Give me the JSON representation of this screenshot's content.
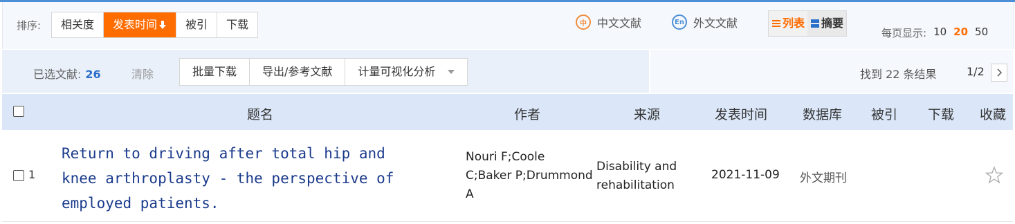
{
  "sort": {
    "label": "排序:",
    "options": [
      "相关度",
      "发表时间",
      "被引",
      "下载"
    ],
    "active_index": 1,
    "active_direction_icon": "arrow-down-icon"
  },
  "language_filters": [
    {
      "icon_text": "中",
      "label": "中文文献",
      "color": "#f08c3c"
    },
    {
      "icon_text": "En",
      "label": "外文文献",
      "color": "#4a8fd6"
    }
  ],
  "view_toggle": {
    "list_label": "列表",
    "abstract_label": "摘要",
    "active": "list"
  },
  "per_page": {
    "label": "每页显示:",
    "options": [
      "10",
      "20",
      "50"
    ],
    "active": "20"
  },
  "selection": {
    "label": "已选文献:",
    "count": "26",
    "clear_label": "清除"
  },
  "actions": [
    "批量下载",
    "导出/参考文献",
    "计量可视化分析"
  ],
  "results": {
    "found_text": "找到 22 条结果",
    "page_indicator": "1/2",
    "next_icon": "chevron-right-icon"
  },
  "table": {
    "headers": [
      "题名",
      "作者",
      "来源",
      "发表时间",
      "数据库",
      "被引",
      "下载",
      "收藏"
    ],
    "rows": [
      {
        "num": "1",
        "title": "Return to driving after total hip and knee arthroplasty - the perspective of employed patients.",
        "authors": "Nouri F;Coole C;Baker P;Drummond A",
        "source": "Disability and rehabilitation",
        "date": "2021-11-09",
        "database": "外文期刊",
        "cited": "",
        "downloads": ""
      }
    ]
  },
  "colors": {
    "accent": "#ff6c00",
    "link": "#1a3a8c",
    "header_bg": "#dbe7f8",
    "count": "#2a6fc9"
  }
}
